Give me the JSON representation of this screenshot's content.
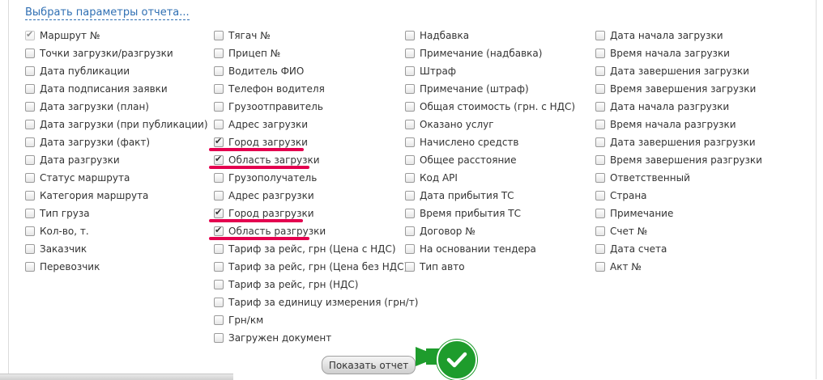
{
  "header": {
    "title": "Выбрать параметры отчета..."
  },
  "columns": [
    [
      {
        "label": "Маршрут №",
        "checked": true,
        "disabled": true
      },
      {
        "label": "Точки загрузки/разгрузки",
        "checked": false
      },
      {
        "label": "Дата публикации",
        "checked": false
      },
      {
        "label": "Дата подписания заявки",
        "checked": false
      },
      {
        "label": "Дата загрузки (план)",
        "checked": false
      },
      {
        "label": "Дата загрузки (при публикации)",
        "checked": false
      },
      {
        "label": "Дата загрузки (факт)",
        "checked": false
      },
      {
        "label": "Дата разгрузки",
        "checked": false
      },
      {
        "label": "Статус маршрута",
        "checked": false
      },
      {
        "label": "Категория маршрута",
        "checked": false
      },
      {
        "label": "Тип груза",
        "checked": false
      },
      {
        "label": "Кол-во, т.",
        "checked": false
      },
      {
        "label": "Заказчик",
        "checked": false
      },
      {
        "label": "Перевозчик",
        "checked": false
      }
    ],
    [
      {
        "label": "Тягач №",
        "checked": false
      },
      {
        "label": "Прицеп №",
        "checked": false
      },
      {
        "label": "Водитель ФИО",
        "checked": false
      },
      {
        "label": "Телефон водителя",
        "checked": false
      },
      {
        "label": "Грузоотправитель",
        "checked": false
      },
      {
        "label": "Адрес загрузки",
        "checked": false
      },
      {
        "label": "Город загрузки",
        "checked": true
      },
      {
        "label": "Область загрузки",
        "checked": true
      },
      {
        "label": "Грузополучатель",
        "checked": false
      },
      {
        "label": "Адрес разгрузки",
        "checked": false
      },
      {
        "label": "Город разгрузки",
        "checked": true
      },
      {
        "label": "Область разгрузки",
        "checked": true
      },
      {
        "label": "Тариф за рейс, грн (Цена с НДС)",
        "checked": false
      },
      {
        "label": "Тариф за рейс, грн (Цена без НДС)",
        "checked": false
      },
      {
        "label": "Тариф за рейс, грн (НДС)",
        "checked": false
      },
      {
        "label": "Тариф за единицу измерения (грн/т)",
        "checked": false
      },
      {
        "label": "Грн/км",
        "checked": false
      },
      {
        "label": "Загружен документ",
        "checked": false
      }
    ],
    [
      {
        "label": "Надбавка",
        "checked": false
      },
      {
        "label": "Примечание (надбавка)",
        "checked": false
      },
      {
        "label": "Штраф",
        "checked": false
      },
      {
        "label": "Примечание (штраф)",
        "checked": false
      },
      {
        "label": "Общая стоимость (грн. с НДС)",
        "checked": false
      },
      {
        "label": "Оказано услуг",
        "checked": false
      },
      {
        "label": "Начислено средств",
        "checked": false
      },
      {
        "label": "Общее расстояние",
        "checked": false
      },
      {
        "label": "Код API",
        "checked": false
      },
      {
        "label": "Дата прибытия ТС",
        "checked": false
      },
      {
        "label": "Время прибытия ТС",
        "checked": false
      },
      {
        "label": "Договор №",
        "checked": false
      },
      {
        "label": "На основании тендера",
        "checked": false
      },
      {
        "label": "Тип авто",
        "checked": false
      }
    ],
    [
      {
        "label": "Дата начала загрузки",
        "checked": false
      },
      {
        "label": "Время начала загрузки",
        "checked": false
      },
      {
        "label": "Дата завершения загрузки",
        "checked": false
      },
      {
        "label": "Время завершения загрузки",
        "checked": false
      },
      {
        "label": "Дата начала разгрузки",
        "checked": false
      },
      {
        "label": "Время начала разгрузки",
        "checked": false
      },
      {
        "label": "Дата завершения разгрузки",
        "checked": false
      },
      {
        "label": "Время завершения разгрузки",
        "checked": false
      },
      {
        "label": "Ответственный",
        "checked": false
      },
      {
        "label": "Страна",
        "checked": false
      },
      {
        "label": "Примечание",
        "checked": false
      },
      {
        "label": "Счет №",
        "checked": false
      },
      {
        "label": "Дата счета",
        "checked": false
      },
      {
        "label": "Акт №",
        "checked": false
      }
    ]
  ],
  "submit": {
    "label": "Показать отчет"
  },
  "colors": {
    "highlight": "#e4004f",
    "accent_green": "#1e9c2c",
    "link": "#2f6fb3"
  },
  "icons": {
    "confirm": "check-circle-icon"
  }
}
